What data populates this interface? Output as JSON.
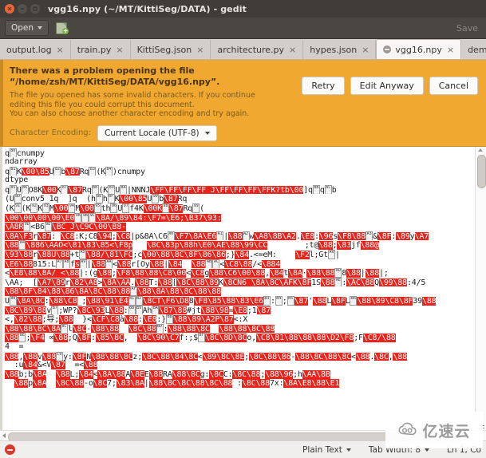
{
  "window": {
    "title": "vgg16.npy (~/MT/KittiSeg/DATA) - gedit",
    "close_icon": "close-icon",
    "minimize_icon": "minimize-icon",
    "maximize_icon": "maximize-icon"
  },
  "toolbar": {
    "open_label": "Open",
    "open_caret_icon": "chevron-down-icon",
    "new_document_icon": "new-document-icon",
    "save_label": "Save"
  },
  "tabs": [
    {
      "label": "output.log",
      "close": "×",
      "active": false,
      "error": false
    },
    {
      "label": "train.py",
      "close": "×",
      "active": false,
      "error": false
    },
    {
      "label": "KittiSeg.json",
      "close": "×",
      "active": false,
      "error": false
    },
    {
      "label": "architecture.py",
      "close": "×",
      "active": false,
      "error": false
    },
    {
      "label": "hypes.json",
      "close": "×",
      "active": false,
      "error": false
    },
    {
      "label": "vgg16.npy",
      "close": "×",
      "active": true,
      "error": true
    },
    {
      "label": "demo.py",
      "close": "×",
      "active": false,
      "error": false
    }
  ],
  "infobar": {
    "headline": "There was a problem opening the file “/home/zsh/MT/KittiSeg/DATA/vgg16.npy”.",
    "detail_line1": "The file you opened has some invalid characters. If you continue editing this file you could corrupt this document.",
    "detail_line2": "You can also choose another character encoding and try again.",
    "buttons": {
      "retry": "Retry",
      "edit_anyway": "Edit Anyway",
      "cancel": "Cancel"
    },
    "encoding_label": "Character Encoding:",
    "encoding_value": "Current Locale (UTF-8)",
    "encoding_caret_icon": "chevron-down-icon",
    "background_color": "#f0a830"
  },
  "editor": {
    "lines": [
      [
        {
          "t": "q"
        },
        {
          "c": "80"
        },
        {
          "t": "cnumpy"
        }
      ],
      [
        {
          "t": "ndarray"
        }
      ],
      [
        {
          "t": "q"
        },
        {
          "c": "81"
        },
        {
          "t": "K"
        },
        {
          "b": "\\00\\85"
        },
        {
          "t": "U"
        },
        {
          "c": "82"
        },
        {
          "t": "b"
        },
        {
          "b": "\\87"
        },
        {
          "t": "Rq"
        },
        {
          "c": "83"
        },
        {
          "t": "(K"
        },
        {
          "c": "84"
        },
        {
          "t": ")cnumpy"
        }
      ],
      [
        {
          "t": "dtype"
        }
      ],
      [
        {
          "t": "q"
        },
        {
          "c": "85"
        },
        {
          "t": "U"
        },
        {
          "c": "86"
        },
        {
          "t": "O8K"
        },
        {
          "b": "\\00"
        },
        {
          "t": "K"
        },
        {
          "c": "87"
        },
        {
          "b": "\\87"
        },
        {
          "t": "Rq"
        },
        {
          "c": "88"
        },
        {
          "t": "(K"
        },
        {
          "c": "89"
        },
        {
          "t": "U"
        },
        {
          "c": "8A"
        },
        {
          "t": "|NNNJ"
        },
        {
          "b": "\\FF\\FF\\FF\\FF J\\FF\\FF\\FF\\FFK?tb"
        },
        {
          "b": "\\00"
        },
        {
          "t": "]q"
        },
        {
          "c": "8B"
        },
        {
          "t": "q"
        },
        {
          "c": "8C"
        },
        {
          "t": "b"
        }
      ],
      [
        {
          "t": "(U"
        },
        {
          "c": "8D"
        },
        {
          "t": "conv5_1q  ]q  (h"
        },
        {
          "c": "8E"
        },
        {
          "t": "h"
        },
        {
          "c": "8F"
        },
        {
          "t": "K"
        },
        {
          "b": "\\00\\85"
        },
        {
          "t": "U"
        },
        {
          "c": "90"
        },
        {
          "t": "b"
        },
        {
          "b": "\\87"
        },
        {
          "t": "Rq"
        }
      ],
      [
        {
          "t": "(K"
        },
        {
          "c": "91"
        },
        {
          "t": "(K"
        },
        {
          "c": "92"
        },
        {
          "t": "K"
        },
        {
          "c": "93"
        },
        {
          "t": "M"
        },
        {
          "b": "\\00"
        },
        {
          "c": "94"
        },
        {
          "t": "M"
        },
        {
          "b": "\\00"
        },
        {
          "c": "95"
        },
        {
          "t": "th"
        },
        {
          "c": "96"
        },
        {
          "t": "U"
        },
        {
          "c": "97"
        },
        {
          "t": "f4K"
        },
        {
          "b": "\\00K"
        },
        {
          "c": "98"
        },
        {
          "b": "\\87"
        },
        {
          "t": "Rq"
        },
        {
          "c": "99"
        },
        {
          "t": "("
        }
      ],
      [
        {
          "b": "\\00\\00\\00\\00\\E0"
        },
        {
          "c": "9A"
        },
        {
          "c": "9B"
        },
        {
          "c": "9C"
        },
        {
          "b": "\\8A/\\89\\84:\\F7=\\E6;\\B37\\93:"
        },
        {
          "b": ""
        }
      ],
      [
        {
          "b": "\\A8R"
        },
        {
          "c": "9D"
        },
        {
          "t": "<B6"
        },
        {
          "c": "9E"
        },
        {
          "b": "\\BC J\\C9C\\00\\B8-"
        }
      ],
      [
        {
          "b": "\\8A\\F3"
        },
        {
          "t": "r"
        },
        {
          "b": "\\87"
        },
        {
          "t": ": "
        },
        {
          "b": "\\C8"
        },
        {
          "t": ":K;C8"
        },
        {
          "b": "\\94"
        },
        {
          "t": ";"
        },
        {
          "b": "\\C8"
        },
        {
          "t": "|p&8A\\C6"
        },
        {
          "c": "A0"
        },
        {
          "b": "\\F7\\8A\\E6"
        },
        {
          "c": "A1"
        },
        {
          "t": "|"
        },
        {
          "b": "\\88"
        },
        {
          "c": "A2"
        },
        {
          "t": "w"
        },
        {
          "b": "\\A8\\8B\\A2"
        },
        {
          "t": "."
        },
        {
          "b": "\\E8"
        },
        {
          "t": ":"
        },
        {
          "b": "\\96"
        },
        {
          "t": "s"
        },
        {
          "b": "\\F8\\88"
        },
        {
          "c": "A3"
        },
        {
          "t": "&"
        },
        {
          "b": "\\8F"
        },
        {
          "t": ":"
        },
        {
          "b": "\\89"
        },
        {
          "t": "y"
        },
        {
          "b": "\\A7"
        }
      ],
      [
        {
          "b": "\\88"
        },
        {
          "c": "A4"
        },
        {
          "b": "\\886\\AAO<\\81\\83\\85<\\F8p"
        },
        {
          "t": "   "
        },
        {
          "b": "\\8C\\83p\\88h\\E0\\AE\\88\\99\\CC"
        },
        {
          "t": "        ;t@"
        },
        {
          "b": "\\88"
        },
        {
          "t": ";"
        },
        {
          "b": "\\83"
        },
        {
          "t": "jf"
        },
        {
          "b": "\\88@"
        }
      ],
      [
        {
          "b": "\\93\\88"
        },
        {
          "t": "r"
        },
        {
          "b": "\\88U\\88"
        },
        {
          "t": "+t"
        },
        {
          "c": "A5"
        },
        {
          "b": "\\88/\\81\\FC"
        },
        {
          "t": ";c"
        },
        {
          "b": "\\00\\88\\8C\\8F\\86\\86"
        },
        {
          "t": ";}"
        },
        {
          "b": "\\84"
        },
        {
          "t": ".<=eM:"
        },
        {
          "t": "    "
        },
        {
          "b": "\\F2"
        },
        {
          "t": "l;Gt"
        },
        {
          "c": "A6"
        },
        {
          "t": "|"
        }
      ],
      [
        {
          "b": "\\E6\\88"
        },
        {
          "t": "815:L"
        },
        {
          "c": "A7"
        },
        {
          "c": "A8"
        },
        {
          "t": "f"
        },
        {
          "b": "s"
        },
        {
          "c": "A9"
        },
        {
          "t": "|"
        },
        {
          "b": "\\88"
        },
        {
          "c": "AA"
        },
        {
          "t": "<"
        },
        {
          "b": "\\88"
        },
        {
          "t": "r[Oy"
        },
        {
          "b": "\\88"
        },
        {
          "t": "|"
        },
        {
          "b": "\\84"
        },
        {
          "t": "  "
        },
        {
          "b": "\\88"
        },
        {
          "c": "AB"
        },
        {
          "c": "AC"
        },
        {
          "t": "<"
        },
        {
          "b": "\\C8\\88"
        },
        {
          "t": "/<"
        },
        {
          "b": "\\884"
        }
      ],
      [
        {
          "t": "<"
        },
        {
          "b": "\\E8\\88\\8A/ <"
        },
        {
          "b": "\\88"
        },
        {
          "t": "|:"
        },
        {
          "t": "(g"
        },
        {
          "b": "\\88"
        },
        {
          "t": ";"
        },
        {
          "b": "\\F8\\88\\88\\C8\\00"
        },
        {
          "t": "<"
        },
        {
          "b": "\\C8"
        },
        {
          "t": "g"
        },
        {
          "b": "\\88\\C6\\00\\88"
        },
        {
          "t": ","
        },
        {
          "b": "\\84"
        },
        {
          "t": "t"
        },
        {
          "b": "\\8A"
        },
        {
          "t": "·"
        },
        {
          "b": "\\88\\88"
        },
        {
          "c": "AD"
        },
        {
          "t": "8"
        },
        {
          "b": "\\88"
        },
        {
          "t": "|"
        },
        {
          "b": "\\88"
        },
        {
          "t": "|;"
        }
      ],
      [
        {
          "t": "\\AA;  ["
        },
        {
          "b": "\\A7\\89"
        },
        {
          "t": "r"
        },
        {
          "b": "\\82\\A8"
        },
        {
          "t": ">"
        },
        {
          "b": "\\8A\\AA"
        },
        {
          "t": "."
        },
        {
          "b": "\\88"
        },
        {
          "t": "T:"
        },
        {
          "b": "\\88"
        },
        {
          "t": "["
        },
        {
          "b": "\\8C\\88\\89"
        },
        {
          "t": "K"
        },
        {
          "b": "\\8CN6_\\8A\\8C\\AFK\\8F"
        },
        {
          "t": "1S"
        },
        {
          "b": "\\88"
        },
        {
          "c": "AE"
        },
        {
          "t": ":"
        },
        {
          "b": "\\AC\\88"
        },
        {
          "t": "Q"
        },
        {
          "b": "\\99\\88"
        },
        {
          "t": ":4/5"
        }
      ],
      [
        {
          "b": "\\88\\8F\\84\\88\\86\\8A\\8C\\88\\88"
        },
        {
          "c": "AF"
        },
        {
          "b": "\\88\\8A\\88\\8C\\88\\88"
        }
      ],
      [
        {
          "t": "U"
        },
        {
          "c": "B0"
        },
        {
          "b": "\\8A\\8C"
        },
        {
          "t": ":"
        },
        {
          "b": "\\88\\C8"
        },
        {
          "t": "_;"
        },
        {
          "b": "\\88\\91\\E4"
        },
        {
          "c": "B1"
        },
        {
          "c": "B2"
        },
        {
          "b": "\\8CT\\F6\\D8"
        },
        {
          "t": "8"
        },
        {
          "b": "\\F8\\85\\88\\83\\E6"
        },
        {
          "c": "B3"
        },
        {
          "t": ":"
        },
        {
          "c": "B4"
        },
        {
          "t": ";"
        },
        {
          "c": "B5"
        },
        {
          "b": "\\87"
        },
        {
          "t": "'"
        },
        {
          "b": "\\88"
        },
        {
          "t": "L"
        },
        {
          "b": "\\8F"
        },
        {
          "t": "L"
        },
        {
          "c": "B6"
        },
        {
          "b": "\\88\\89\\C8\\8F"
        },
        {
          "t": "39"
        },
        {
          "b": "\\88"
        }
      ],
      [
        {
          "b": "\\8C\\89\\88"
        },
        {
          "t": "v"
        },
        {
          "c": "B7"
        },
        {
          "t": ";WP?"
        },
        {
          "b": "\\8C\\93"
        },
        {
          "t": "L"
        },
        {
          "b": "\\88"
        },
        {
          "t": ":"
        },
        {
          "c": "B8"
        },
        {
          "c": "B9"
        },
        {
          "t": "Ah"
        },
        {
          "c": "BA"
        },
        {
          "b": "\\87\\88"
        },
        {
          "t": "#jt"
        },
        {
          "b": "\\88\\98"
        },
        {
          "t": "="
        },
        {
          "b": "\\E8"
        },
        {
          "t": ";1"
        },
        {
          "b": "\\87"
        }
      ],
      [
        {
          "t": "<,"
        },
        {
          "b": "\\82\\88"
        },
        {
          "t": ";导;"
        },
        {
          "b": "\\88"
        },
        {
          "t": "  }<"
        },
        {
          "b": "\\CF\\C8"
        },
        {
          "t": "à"
        },
        {
          "b": "\\88"
        },
        {
          "t": ":"
        },
        {
          "b": "\\E8"
        },
        {
          "t": ":}"
        },
        {
          "c": "BB"
        },
        {
          "b": "\\88\\89\\A2P\\87"
        },
        {
          "t": "<:X"
        }
      ],
      [
        {
          "b": "\\88\\88\\8C\\8A"
        },
        {
          "c": "BC"
        },
        {
          "t": "l"
        },
        {
          "b": "\\8C"
        },
        {
          "t": "-"
        },
        {
          "b": "\\88\\88"
        },
        {
          "t": "  "
        },
        {
          "b": "\\8C\\88"
        },
        {
          "c": "BD"
        },
        {
          "t": ":"
        },
        {
          "b": "\\88\\88\\8C"
        },
        {
          "t": "  "
        },
        {
          "b": "\\88\\88\\8C\\88"
        }
      ],
      [
        {
          "b": "\\88"
        },
        {
          "c": "BE"
        },
        {
          "t": ";"
        },
        {
          "b": "\\F4"
        },
        {
          "t": " ∞"
        },
        {
          "b": "\\88"
        },
        {
          "t": ";Q"
        },
        {
          "b": "\\8F"
        },
        {
          "t": ":"
        },
        {
          "b": "\\85\\8C"
        },
        {
          "t": ",  "
        },
        {
          "b": "\\8C\\90\\C7"
        },
        {
          "t": "f:;$"
        },
        {
          "c": "BF"
        },
        {
          "b": "\\8C\\8D\\8C"
        },
        {
          "t": "o,"
        },
        {
          "b": "\\C8\\81\\88\\88\\88\\D2\\F8"
        },
        {
          "t": ";F"
        },
        {
          "b": "\\C8/\\88"
        }
      ],
      [
        {
          "t": "4  ="
        }
      ],
      [
        {
          "b": "\\88"
        },
        {
          "t": ","
        },
        {
          "b": "\\88"
        },
        {
          "t": "v"
        },
        {
          "b": "\\88"
        },
        {
          "c": "C0"
        },
        {
          "t": "y:"
        },
        {
          "b": "\\8F"
        },
        {
          "t": "N"
        },
        {
          "b": "\\88\\88\\8C"
        },
        {
          "t": "z;"
        },
        {
          "b": "\\8C\\88\\84\\8C"
        },
        {
          "t": "<"
        },
        {
          "b": "\\89\\8C\\8E"
        },
        {
          "t": ";"
        },
        {
          "b": "\\8C\\88\\86"
        },
        {
          "t": "-"
        },
        {
          "b": "\\88\\8C\\88\\8C"
        },
        {
          "t": "<"
        },
        {
          "b": "\\88"
        },
        {
          "t": "."
        },
        {
          "b": "\\8C"
        },
        {
          "t": ","
        },
        {
          "b": "\\88"
        }
      ],
      [
        {
          "t": "  :u"
        },
        {
          "b": "\\84"
        },
        {
          "t": "&<V"
        },
        {
          "b": "\\87"
        },
        {
          "t": "  =<"
        },
        {
          "b": "\\88"
        },
        {
          "t": " "
        }
      ],
      [
        {
          "b": "\\88"
        },
        {
          "t": "b;b"
        },
        {
          "b": "\\8A"
        },
        {
          "t": "  "
        },
        {
          "b": "\\88"
        },
        {
          "t": "L;"
        },
        {
          "b": "\\84"
        },
        {
          "t": "<"
        },
        {
          "b": "\\8A\\88"
        },
        {
          "t": "A"
        },
        {
          "b": "\\8E"
        },
        {
          "t": "E"
        },
        {
          "b": "\\88"
        },
        {
          "t": "RA"
        },
        {
          "b": "\\88\\8C"
        },
        {
          "t": "g:"
        },
        {
          "b": "\\8C"
        },
        {
          "t": "C:"
        },
        {
          "b": "\\8C\\88"
        },
        {
          "t": ";"
        },
        {
          "b": "\\88\\96"
        },
        {
          "t": ";h"
        },
        {
          "b": "\\AA\\8B"
        }
      ],
      [
        {
          "t": "  "
        },
        {
          "b": "\\88"
        },
        {
          "t": "p"
        },
        {
          "b": "\\8A"
        },
        {
          "t": "  "
        },
        {
          "b": "\\8C\\88"
        },
        {
          "t": "-o"
        },
        {
          "b": "\\8C"
        },
        {
          "t": "7;"
        },
        {
          "b": "\\83\\8A"
        },
        {
          "t": "|"
        },
        {
          "b": "\\88\\8C\\8C\\88\\8C\\88"
        },
        {
          "t": " :"
        },
        {
          "b": "\\8C\\88"
        },
        {
          "t": "7x:"
        },
        {
          "b": "\\8A\\E8\\88\\E1"
        },
        {
          "t": " "
        }
      ]
    ]
  },
  "scrollbars": {
    "vertical_up_icon": "scroll-up-arrow-icon",
    "vertical_down_icon": "scroll-down-arrow-icon",
    "horizontal_left_icon": "scroll-left-arrow-icon"
  },
  "statusbar": {
    "error_icon": "error-icon",
    "language": "Plain Text",
    "tab_width": "Tab Width: 8",
    "cursor_position": "Ln 1, Co",
    "caret_icon": "chevron-down-icon"
  },
  "watermark": {
    "logo_icon": "cloud-logo-icon",
    "text": "亿速云",
    "url": "https://www.yisu.com"
  }
}
